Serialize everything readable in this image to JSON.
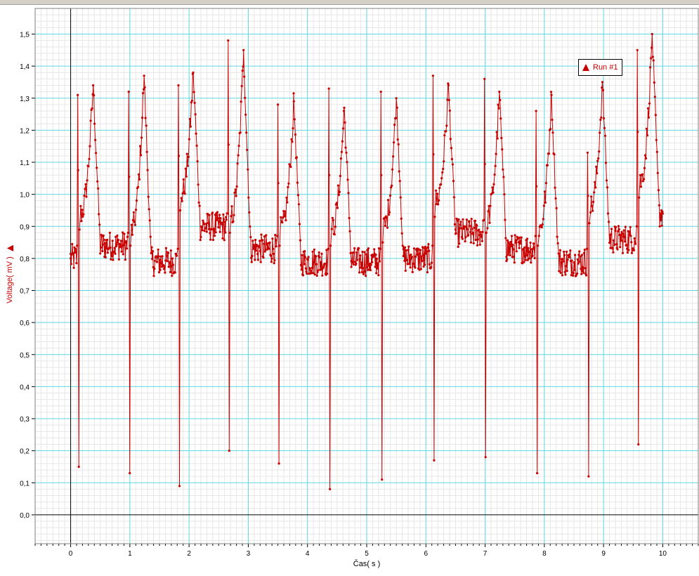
{
  "chart_data": {
    "type": "line",
    "title": "",
    "xlabel": "Čas( s )",
    "ylabel": "Voltage( mV )",
    "xlim": [
      -0.6,
      10.6
    ],
    "ylim": [
      -0.09,
      1.58
    ],
    "xticks": [
      "0",
      "1",
      "2",
      "3",
      "4",
      "5",
      "6",
      "7",
      "8",
      "9",
      "10"
    ],
    "yticks": [
      "0,0",
      "0,1",
      "0,2",
      "0,3",
      "0,4",
      "0,5",
      "0,6",
      "0,7",
      "0,8",
      "0,9",
      "1,0",
      "1,1",
      "1,2",
      "1,3",
      "1,4",
      "1,5"
    ],
    "grid": true,
    "legend_position": "top-right",
    "colors": {
      "series": "#c80000",
      "major_grid": "#5ed8e0",
      "minor_grid": "#e6e6e6",
      "axis": "#000000"
    },
    "series": [
      {
        "name": "Run #1",
        "marker": "triangle-icon",
        "beats": [
          {
            "peak": 0.12,
            "r": 1.31,
            "s": 0.15,
            "t_time": 0.38,
            "t_amp": 1.34
          },
          {
            "peak": 0.98,
            "r": 1.32,
            "s": 0.13,
            "t_time": 1.24,
            "t_amp": 1.37
          },
          {
            "peak": 1.82,
            "r": 1.34,
            "s": 0.09,
            "t_time": 2.07,
            "t_amp": 1.38
          },
          {
            "peak": 2.66,
            "r": 1.48,
            "s": 0.2,
            "t_time": 2.92,
            "t_amp": 1.45
          },
          {
            "peak": 3.5,
            "r": 1.28,
            "s": 0.16,
            "t_time": 3.77,
            "t_amp": 1.29
          },
          {
            "peak": 4.36,
            "r": 1.33,
            "s": 0.08,
            "t_time": 4.62,
            "t_amp": 1.27
          },
          {
            "peak": 5.24,
            "r": 1.32,
            "s": 0.11,
            "t_time": 5.5,
            "t_amp": 1.3
          },
          {
            "peak": 6.12,
            "r": 1.37,
            "s": 0.17,
            "t_time": 6.38,
            "t_amp": 1.34
          },
          {
            "peak": 6.99,
            "r": 1.36,
            "s": 0.18,
            "t_time": 7.24,
            "t_amp": 1.32
          },
          {
            "peak": 7.86,
            "r": 1.26,
            "s": 0.13,
            "t_time": 8.12,
            "t_amp": 1.31
          },
          {
            "peak": 8.73,
            "r": 1.13,
            "s": 0.12,
            "t_time": 8.98,
            "t_amp": 1.35
          },
          {
            "peak": 9.57,
            "r": 1.45,
            "s": 0.22,
            "t_time": 9.82,
            "t_amp": 1.5
          }
        ],
        "segment_baseline": [
          0.8,
          0.84,
          0.79,
          0.9,
          0.83,
          0.79,
          0.79,
          0.8,
          0.88,
          0.83,
          0.79,
          0.86,
          0.94
        ],
        "start_value": 0.8,
        "end_value": 0.94,
        "x_start": 0.0,
        "x_end": 10.0
      }
    ]
  }
}
